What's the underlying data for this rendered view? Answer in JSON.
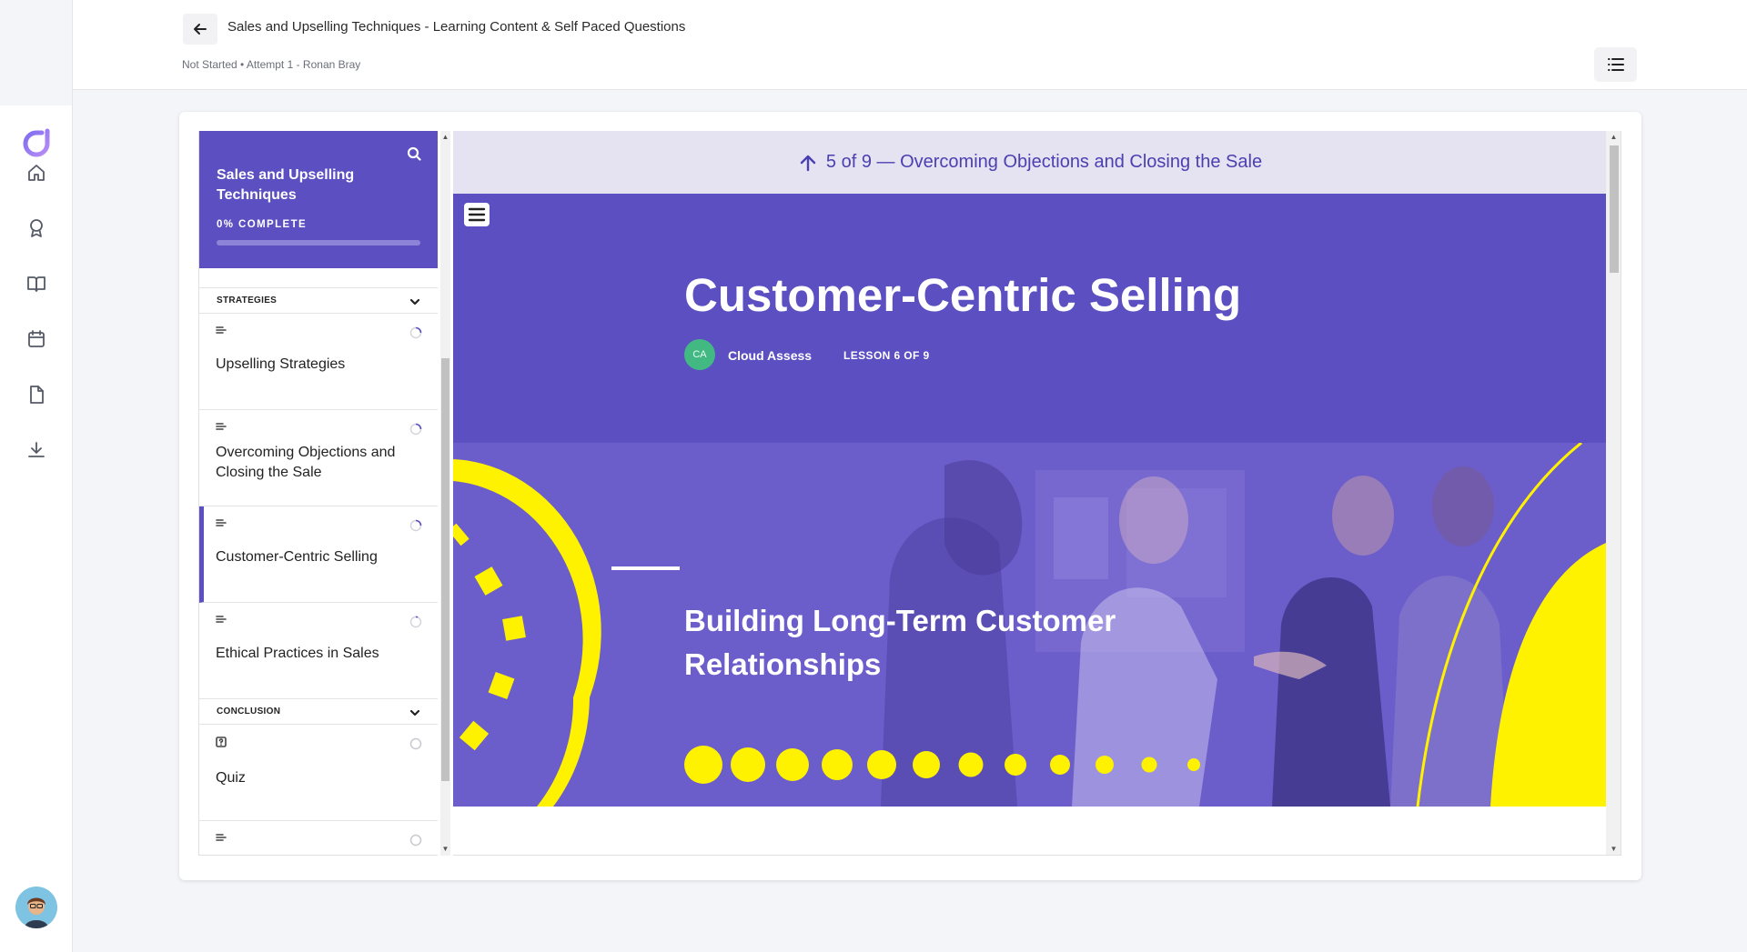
{
  "header": {
    "title": "Sales and Upselling Techniques - Learning Content & Self Paced Questions",
    "meta": "Not Started • Attempt 1 - Ronan Bray"
  },
  "nav": {
    "items": [
      {
        "name": "home-icon"
      },
      {
        "name": "award-icon"
      },
      {
        "name": "book-icon"
      },
      {
        "name": "calendar-icon"
      },
      {
        "name": "document-icon"
      },
      {
        "name": "download-icon"
      }
    ]
  },
  "course": {
    "title": "Sales and Upselling Techniques",
    "progress_label": "0% COMPLETE",
    "progress": 0,
    "sections": [
      {
        "label": "STRATEGIES",
        "lessons": [
          {
            "name": "Upselling Strategies",
            "type": "text-icon"
          },
          {
            "name": "Overcoming Objections and Closing the Sale",
            "type": "text-icon"
          },
          {
            "name": "Customer-Centric Selling",
            "type": "text-icon",
            "active": true
          },
          {
            "name": "Ethical Practices in Sales",
            "type": "text-icon"
          }
        ]
      },
      {
        "label": "CONCLUSION",
        "lessons": [
          {
            "name": "Quiz",
            "type": "quiz-icon"
          },
          {
            "name": "",
            "type": "text-icon"
          }
        ]
      }
    ]
  },
  "content": {
    "prev_label": "5 of 9 — Overcoming Objections and Closing the Sale",
    "title": "Customer-Centric Selling",
    "author_initials": "CA",
    "author": "Cloud Assess",
    "lesson_count": "LESSON 6 OF 9",
    "banner_title": "Building Long-Term Customer Relationships"
  },
  "colors": {
    "brand": "#5b4fc2",
    "accent": "#fff200",
    "prev_bar": "#e5e2f2"
  }
}
